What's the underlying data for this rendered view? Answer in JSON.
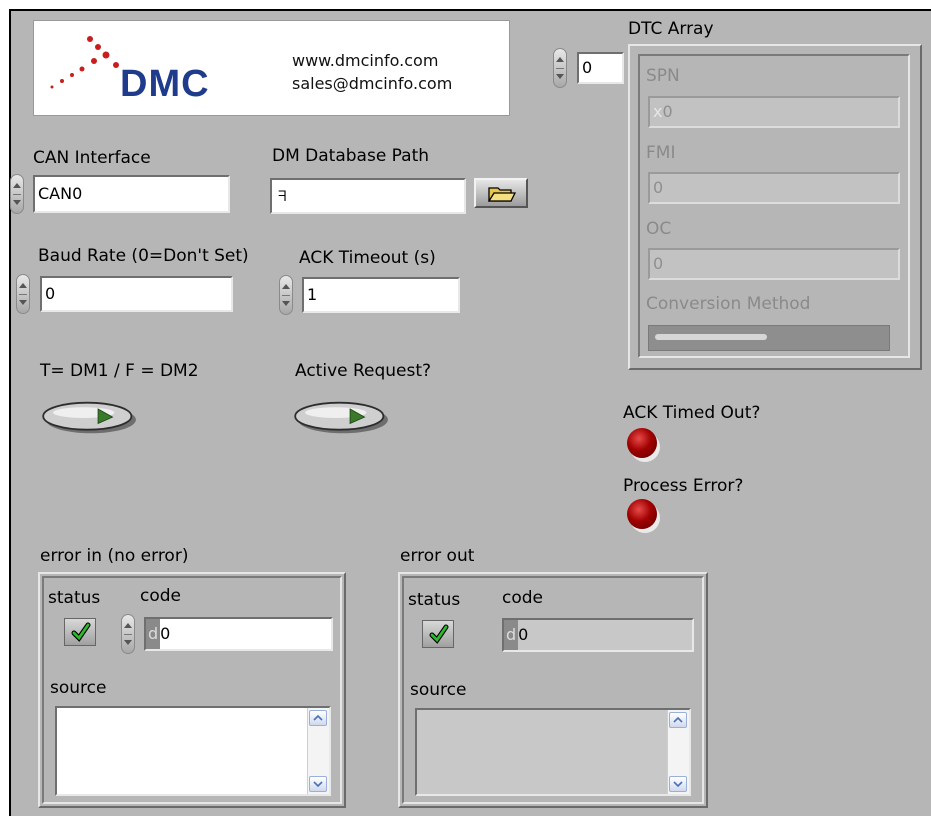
{
  "logo": {
    "text": "DMC",
    "website": "www.dmcinfo.com",
    "email": "sales@dmcinfo.com"
  },
  "can_interface": {
    "label": "CAN Interface",
    "value": "CAN0"
  },
  "dm_database_path": {
    "label": "DM Database Path",
    "value": ""
  },
  "baud_rate": {
    "label": "Baud Rate (0=Don't Set)",
    "value": "0"
  },
  "ack_timeout": {
    "label": "ACK Timeout (s)",
    "value": "1"
  },
  "dm_select": {
    "label": "T= DM1 / F = DM2"
  },
  "active_request": {
    "label": "Active Request?"
  },
  "dtc_array": {
    "label": "DTC Array",
    "index": "0",
    "spn_label": "SPN",
    "spn_radix": "x",
    "spn_value": "0",
    "fmi_label": "FMI",
    "fmi_value": "0",
    "oc_label": "OC",
    "oc_value": "0",
    "conversion_label": "Conversion Method"
  },
  "ack_timed_out": {
    "label": "ACK Timed Out?"
  },
  "process_error": {
    "label": "Process Error?"
  },
  "error_in": {
    "label": "error in (no error)",
    "status_label": "status",
    "code_label": "code",
    "code_radix": "d",
    "code_value": "0",
    "source_label": "source",
    "source_value": ""
  },
  "error_out": {
    "label": "error out",
    "status_label": "status",
    "code_label": "code",
    "code_radix": "d",
    "code_value": "0",
    "source_label": "source",
    "source_value": ""
  },
  "colors": {
    "panel": "#b6b6b6",
    "led_red": "#a00000",
    "logo_blue": "#1f3b8c",
    "logo_red": "#c81e1e",
    "check_green": "#2eb82e",
    "toggle_arrow": "#3a7a2a"
  }
}
